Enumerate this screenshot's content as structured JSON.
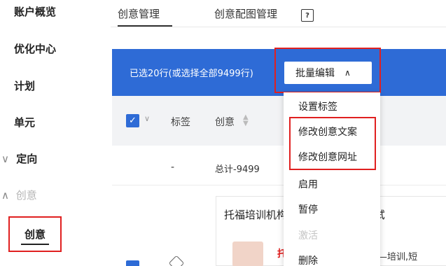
{
  "sidebar": {
    "items": [
      {
        "label": "账户概览"
      },
      {
        "label": "优化中心"
      },
      {
        "label": "计划"
      },
      {
        "label": "单元"
      },
      {
        "label": "定向",
        "arrow": "∨"
      },
      {
        "label": "创意",
        "arrow": "∧"
      }
    ],
    "active": "创意"
  },
  "tabs": {
    "active": "创意管理",
    "second": "创意配图管理",
    "icon_glyph": "?"
  },
  "toolbar": {
    "selection_text": "已选20行(或选择全部9499行)",
    "bulk_edit_label": "批量编辑",
    "bulk_chevron": "∧"
  },
  "table": {
    "header_check": "✓",
    "header_chevron": "∨",
    "col_label": "标签",
    "col_creative": "创意",
    "sort_glyph": "▲\n▼",
    "total_dash": "-",
    "total_text": "总计-9499"
  },
  "row": {
    "title": "托福培训机构哪个好,入学准确测试",
    "red_text": "托",
    "sub_text": "—培训,短"
  },
  "dropdown": {
    "items": [
      "设置标签",
      "修改创意文案",
      "修改创意网址",
      "启用",
      "暂停",
      "激活",
      "删除"
    ],
    "disabled": [
      "激活"
    ]
  },
  "colors": {
    "accent_blue": "#2e6bd6",
    "highlight_red": "#e02020"
  }
}
